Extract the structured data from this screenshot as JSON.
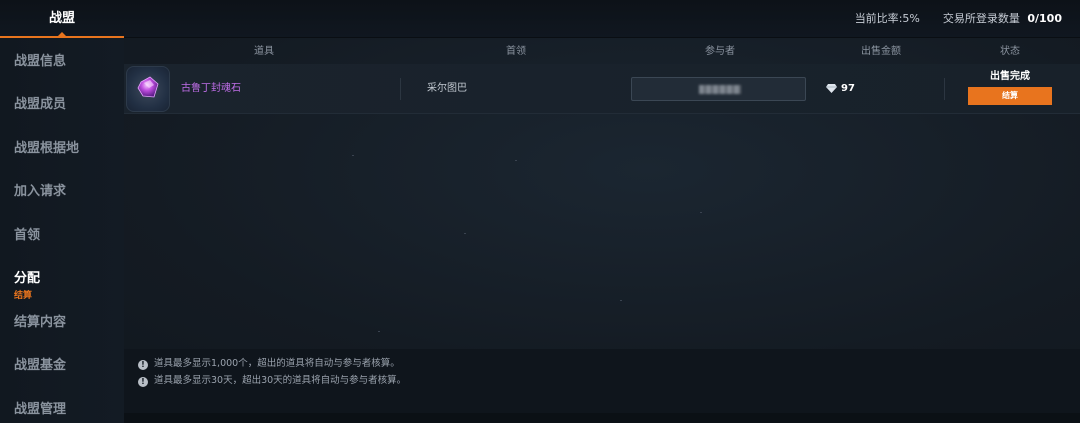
{
  "top": {
    "active_tab": "战盟",
    "ratio_label": "当前比率",
    "ratio_value": ":5%",
    "exchange_label": "交易所登录数量",
    "exchange_count": "0/100"
  },
  "sidebar": {
    "items": [
      {
        "label": "战盟信息"
      },
      {
        "label": "战盟成员"
      },
      {
        "label": "战盟根据地"
      },
      {
        "label": "加入请求"
      },
      {
        "label": "首领"
      },
      {
        "label": "分配",
        "sub": "结算"
      },
      {
        "label": "结算内容"
      },
      {
        "label": "战盟基金"
      },
      {
        "label": "战盟管理"
      }
    ]
  },
  "table": {
    "headers": [
      "道具",
      "首领",
      "参与者",
      "出售金额",
      "状态"
    ],
    "rows": [
      {
        "item_name": "古鲁丁封魂石",
        "leader": "采尔图巴",
        "amount": "97",
        "status": "出售完成",
        "action_label": "结算"
      }
    ]
  },
  "notes": [
    "道具最多显示1,000个，超出的道具将自动与参与者核算。",
    "道具最多显示30天，超出30天的道具将自动与参与者核算。"
  ],
  "colors": {
    "accent": "#e8741e",
    "item_purple": "#c06ee8",
    "background": "#131a22"
  }
}
